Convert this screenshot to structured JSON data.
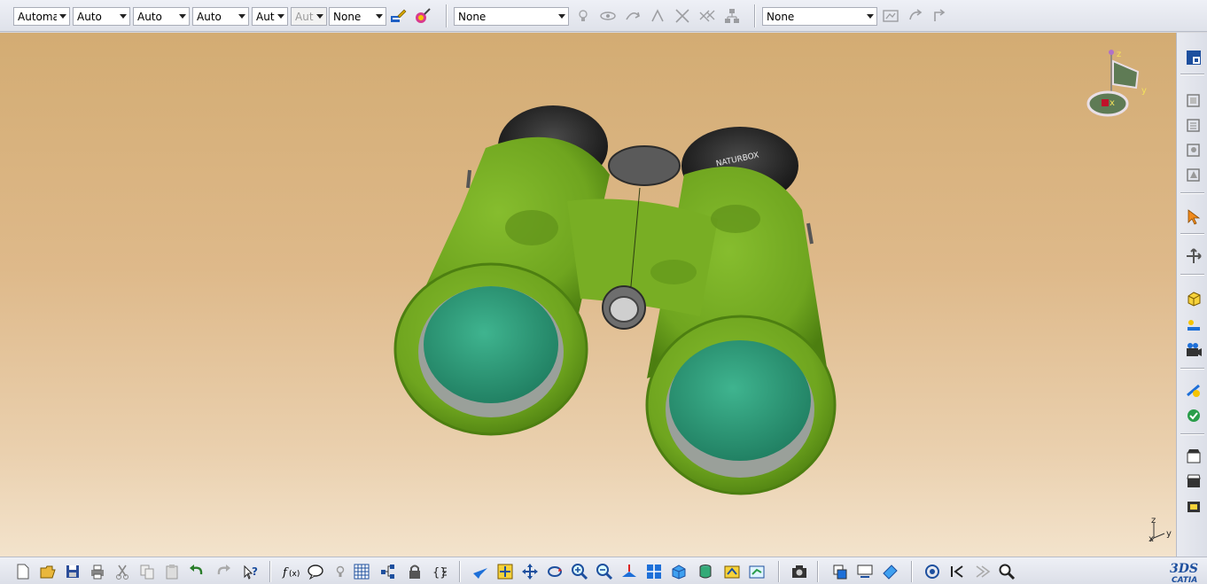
{
  "top_toolbar": {
    "combos": [
      {
        "name": "color-combo",
        "value": "Automa",
        "disabled": false
      },
      {
        "name": "transparency-combo",
        "value": "Auto",
        "disabled": false
      },
      {
        "name": "line-thickness-combo",
        "value": "Auto",
        "disabled": false
      },
      {
        "name": "line-type-combo",
        "value": "Auto",
        "disabled": false
      },
      {
        "name": "point-type-combo",
        "value": "Aut",
        "disabled": false
      },
      {
        "name": "rendering-style-combo",
        "value": "Aut",
        "disabled": true
      },
      {
        "name": "layer-combo",
        "value": "None",
        "disabled": false
      },
      {
        "name": "current-layer-combo",
        "value": "None",
        "disabled": false
      },
      {
        "name": "filter-combo",
        "value": "None",
        "disabled": false
      }
    ]
  },
  "model": {
    "brand_text": "NATURBOX",
    "body_color": "#6fa51f",
    "lens_color": "#2f9f7c"
  },
  "compass": {
    "x_label": "x",
    "y_label": "y",
    "z_label": "z"
  },
  "axis_triad": {
    "x_label": "x",
    "y_label": "y",
    "z_label": "z"
  },
  "catia_logo": {
    "text": "CATIA",
    "mark": "3DS"
  },
  "colors": {
    "accent": "#1d4f9e",
    "viewport_top": "#d3ac73",
    "viewport_bottom": "#f3e3cc"
  }
}
